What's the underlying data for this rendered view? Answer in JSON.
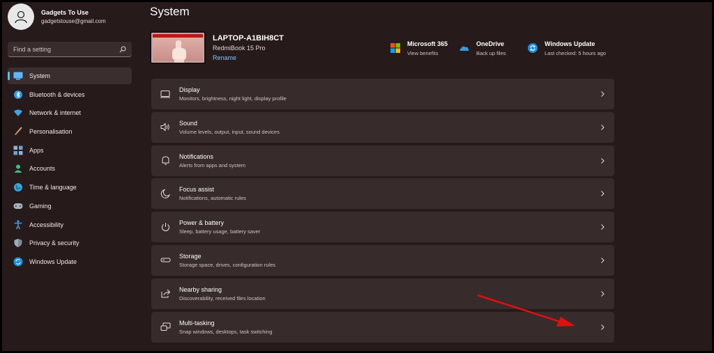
{
  "profile": {
    "name": "Gadgets To Use",
    "email": "gadgetstouse@gmail.com"
  },
  "search": {
    "placeholder": "Find a setting"
  },
  "nav": [
    {
      "label": "System",
      "icon": "system-icon",
      "active": true
    },
    {
      "label": "Bluetooth & devices",
      "icon": "bluetooth-icon"
    },
    {
      "label": "Network & internet",
      "icon": "wifi-icon"
    },
    {
      "label": "Personalisation",
      "icon": "brush-icon"
    },
    {
      "label": "Apps",
      "icon": "apps-icon"
    },
    {
      "label": "Accounts",
      "icon": "accounts-icon"
    },
    {
      "label": "Time & language",
      "icon": "globe-icon"
    },
    {
      "label": "Gaming",
      "icon": "gamepad-icon"
    },
    {
      "label": "Accessibility",
      "icon": "accessibility-icon"
    },
    {
      "label": "Privacy & security",
      "icon": "shield-icon"
    },
    {
      "label": "Windows Update",
      "icon": "update-icon"
    }
  ],
  "page": {
    "title": "System"
  },
  "device": {
    "name": "LAPTOP-A1BIH8CT",
    "model": "RedmiBook 15 Pro",
    "rename": "Rename"
  },
  "quick": [
    {
      "title": "Microsoft 365",
      "sub": "View benefits",
      "icon": "microsoft-icon"
    },
    {
      "title": "OneDrive",
      "sub": "Back up files",
      "icon": "onedrive-icon"
    },
    {
      "title": "Windows Update",
      "sub": "Last checked: 5 hours ago",
      "icon": "windows-update-icon"
    }
  ],
  "settings": [
    {
      "title": "Display",
      "sub": "Monitors, brightness, night light, display profile",
      "icon": "display-icon"
    },
    {
      "title": "Sound",
      "sub": "Volume levels, output, input, sound devices",
      "icon": "speaker-icon"
    },
    {
      "title": "Notifications",
      "sub": "Alerts from apps and system",
      "icon": "bell-icon"
    },
    {
      "title": "Focus assist",
      "sub": "Notifications, automatic rules",
      "icon": "moon-icon"
    },
    {
      "title": "Power & battery",
      "sub": "Sleep, battery usage, battery saver",
      "icon": "power-icon"
    },
    {
      "title": "Storage",
      "sub": "Storage space, drives, configuration rules",
      "icon": "storage-icon"
    },
    {
      "title": "Nearby sharing",
      "sub": "Discoverability, received files location",
      "icon": "share-icon"
    },
    {
      "title": "Multi-tasking",
      "sub": "Snap windows, desktops, task switching",
      "icon": "multitask-icon"
    }
  ],
  "colors": {
    "accent": "#4cc2ff",
    "annotation_arrow": "#e01010",
    "background": "#271a1a",
    "card": "#382b2b"
  }
}
